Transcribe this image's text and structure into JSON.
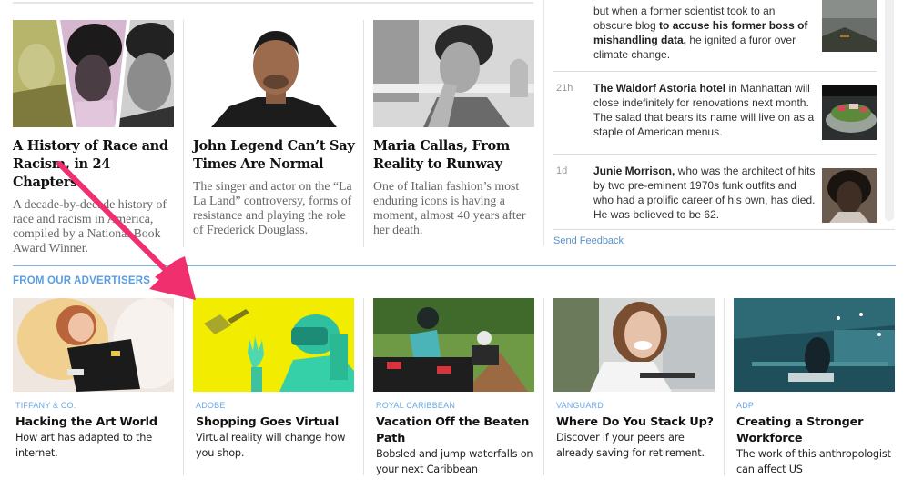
{
  "stories": [
    {
      "title": "A History of Race and Racism, in 24 Chapters",
      "summary": "A decade-by-decade history of race and racism in America, compiled by a National Book Award Winner.",
      "image": "triptych-portraits"
    },
    {
      "title": "John Legend Can’t Say Times Are Normal",
      "summary": "The singer and actor on the “La La Land” controversy, forms of resistance and playing the role of Frederick Douglass.",
      "image": "john-legend-portrait"
    },
    {
      "title": "Maria Callas, From Reality to Runway",
      "summary": "One of Italian fashion’s most enduring icons is having a moment, almost 40 years after her death.",
      "image": "maria-callas-photo"
    }
  ],
  "feed": {
    "items": [
      {
        "time": "",
        "text_pre": "but when a former scientist took to an obscure blog ",
        "text_bold": "to accuse his former boss of mishandling data,",
        "text_post": " he ignited a furor over climate change.",
        "image": "landscape-thumbnail"
      },
      {
        "time": "21h",
        "text_pre": "",
        "text_bold": "The Waldorf Astoria hotel",
        "text_post": " in Manhattan will close indefinitely for renovations next month. The salad that bears its name will live on as a staple of American menus.",
        "image": "waldorf-salad-thumbnail"
      },
      {
        "time": "1d",
        "text_pre": "",
        "text_bold": "Junie Morrison,",
        "text_post": " who was the architect of hits by two pre-eminent 1970s funk outfits and who had a prolific career of his own, has died. He was believed to be 62.",
        "image": "junie-morrison-portrait"
      }
    ],
    "send_feedback": "Send Feedback"
  },
  "advertisers": {
    "heading": "FROM OUR ADVERTISERS",
    "items": [
      {
        "sponsor": "TIFFANY & CO.",
        "title": "Hacking the Art World",
        "summary": "How art has adapted to the internet.",
        "image": "woman-on-bed"
      },
      {
        "sponsor": "ADOBE",
        "title": "Shopping Goes Virtual",
        "summary": "Virtual reality will change how you shop.",
        "image": "vr-headset-yellow"
      },
      {
        "sponsor": "ROYAL CARIBBEAN",
        "title": "Vacation Off the Beaten Path",
        "summary": "Bobsled and jump waterfalls on your next Caribbean",
        "image": "atv-riders"
      },
      {
        "sponsor": "VANGUARD",
        "title": "Where Do You Stack Up?",
        "summary": "Discover if your peers are already saving for retirement.",
        "image": "laughing-cyclist"
      },
      {
        "sponsor": "ADP",
        "title": "Creating a Stronger Workforce",
        "summary": "The work of this anthropologist can affect US",
        "image": "office-atrium"
      }
    ]
  },
  "annotation": {
    "type": "arrow",
    "color": "#f0306e"
  },
  "colors": {
    "accent_blue": "#5a9de0",
    "rule_blue": "#7fb2e5",
    "link_blue": "#5a8fc8",
    "adobe_yellow": "#f2ec00"
  }
}
